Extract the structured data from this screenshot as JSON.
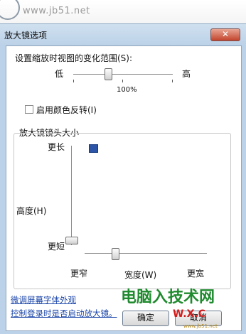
{
  "browser": {
    "url": "www.jb51.net"
  },
  "dialog": {
    "title": "放大镜选项",
    "close_glyph": "✕",
    "zoom_increment": {
      "label": "设置缩放时视图的变化范围(S):",
      "min_label": "低",
      "max_label": "高",
      "value_label": "100%",
      "level": 0.35
    },
    "color_inversion": {
      "label": "启用颜色反转(I)",
      "checked": false
    },
    "lens_size": {
      "label": "放大镜镜头大小",
      "height_label": "高度(H)",
      "height_top": "更长",
      "height_bottom": "更短",
      "width_label": "宽度(W)",
      "width_left": "更窄",
      "width_right": "更宽",
      "height_level": 0.05,
      "width_level": 0.25
    },
    "links": {
      "font_link": "微调屏幕字体外观",
      "logon_link": "控制登录时是否启动放大镜。"
    },
    "buttons": {
      "ok": "确定",
      "cancel": "取消"
    }
  },
  "watermark": {
    "text": "电脑入技术网",
    "small": "www.jb51.net",
    "logo": "W.X.C"
  },
  "colors": {
    "dialog_frame": "#bcd2e8",
    "link": "#1a45a8",
    "watermark": "#1f8a2e",
    "close_button": "#c2442c"
  }
}
